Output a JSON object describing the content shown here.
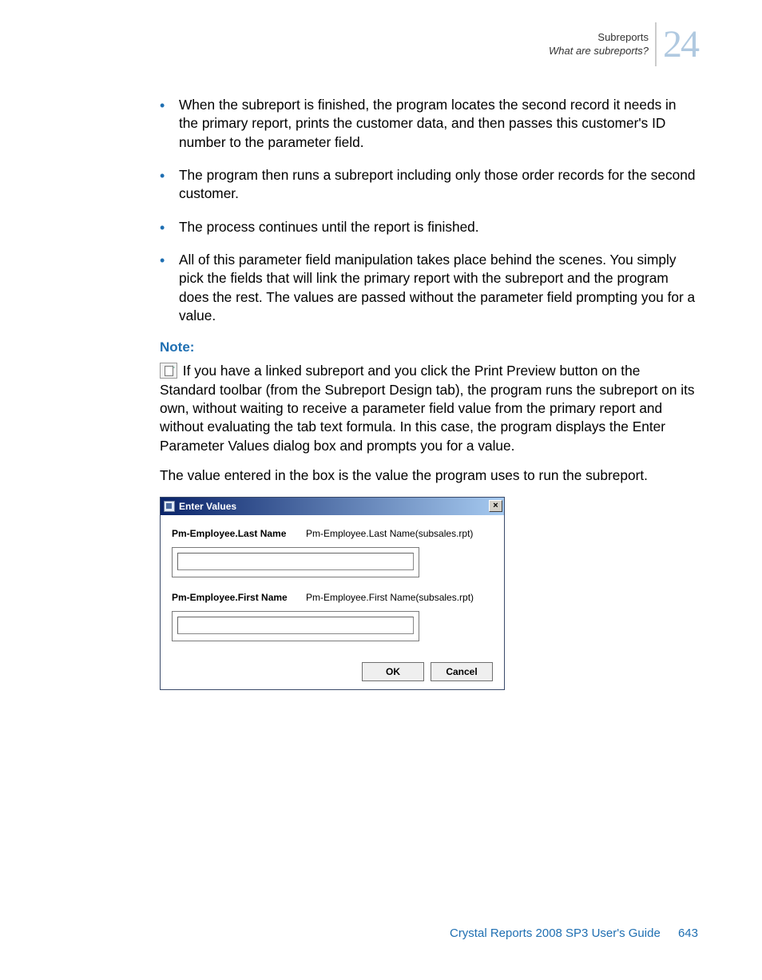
{
  "header": {
    "line1": "Subreports",
    "line2": "What are subreports?",
    "chapter_number": "24"
  },
  "bullets": [
    "When the subreport is finished, the program locates the second record it needs in the primary report, prints the customer data, and then passes this customer's ID number to the parameter field.",
    "The program then runs a subreport including only those order records for the second customer.",
    "The process continues until the report is finished.",
    "All of this parameter field manipulation takes place behind the scenes. You simply pick the fields that will link the primary report with the subreport and the program does the rest. The values are passed without the parameter field prompting you for a value."
  ],
  "note": {
    "label": "Note:",
    "body": " If you have a linked subreport and you click the Print Preview button on the Standard toolbar (from the Subreport Design tab), the program runs the subreport on its own, without waiting to receive a parameter field value from the primary report and without evaluating the tab text formula. In this case, the program displays the Enter Parameter Values dialog box and prompts you for a value."
  },
  "para_after_note": "The value entered in the box is the value the program uses to run the subreport.",
  "dialog": {
    "title": "Enter Values",
    "close_glyph": "×",
    "fields": [
      {
        "label": "Pm-Employee.Last Name",
        "desc": "Pm-Employee.Last Name(subsales.rpt)",
        "value": ""
      },
      {
        "label": "Pm-Employee.First Name",
        "desc": "Pm-Employee.First Name(subsales.rpt)",
        "value": ""
      }
    ],
    "buttons": {
      "ok": "OK",
      "cancel": "Cancel"
    }
  },
  "footer": {
    "title": "Crystal Reports 2008 SP3 User's Guide",
    "page": "643"
  }
}
